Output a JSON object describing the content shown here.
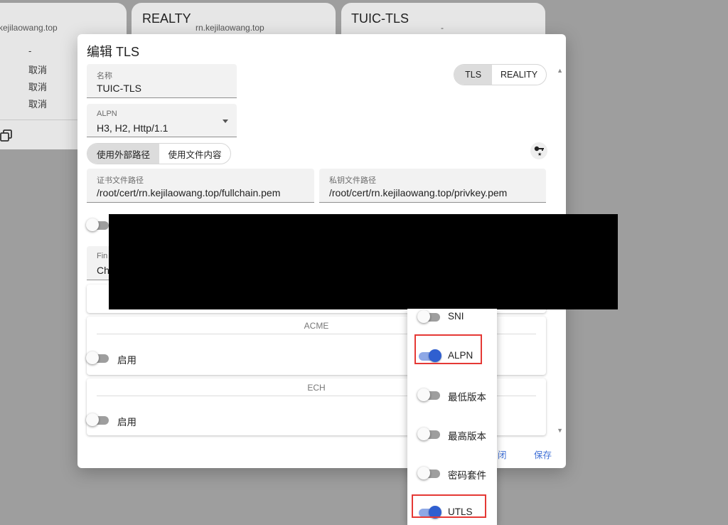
{
  "background": {
    "left_card": {
      "subtitle": "kejilaowang.top",
      "dash": "-",
      "cancels": [
        "取消",
        "取消",
        "取消"
      ]
    },
    "cards": [
      {
        "title": "REALTY",
        "subtitle": "rn.kejilaowang.top"
      },
      {
        "title": "TUIC-TLS",
        "subtitle": "-"
      }
    ]
  },
  "dialog": {
    "title": "编辑 TLS",
    "name_field": {
      "label": "名称",
      "value": "TUIC-TLS"
    },
    "type_toggle": [
      "TLS",
      "REALITY"
    ],
    "alpn_field": {
      "label": "ALPN",
      "value": "H3, H2, Http/1.1"
    },
    "source_toggle": [
      "使用外部路径",
      "使用文件内容"
    ],
    "cert_field": {
      "label": "证书文件路径",
      "value": "/root/cert/rn.kejilaowang.top/fullchain.pem"
    },
    "key_field": {
      "label": "私钥文件路径",
      "value": "/root/cert/rn.kejilaowang.top/privkey.pem"
    },
    "partial_label": "Fin",
    "partial_value": "Ch",
    "acme": {
      "header": "ACME",
      "enable_label": "启用"
    },
    "ech": {
      "header": "ECH",
      "enable_label": "启用"
    },
    "footer": {
      "close_partial": "闭",
      "save": "保存"
    }
  },
  "menu": {
    "items": [
      {
        "label": "SNI",
        "on": false
      },
      {
        "label": "ALPN",
        "on": true
      },
      {
        "label": "最低版本",
        "on": false
      },
      {
        "label": "最高版本",
        "on": false
      },
      {
        "label": "密码套件",
        "on": false
      },
      {
        "label": "UTLS",
        "on": true
      }
    ]
  },
  "colors": {
    "accent": "#2f5fd0",
    "highlight": "#e53935"
  }
}
